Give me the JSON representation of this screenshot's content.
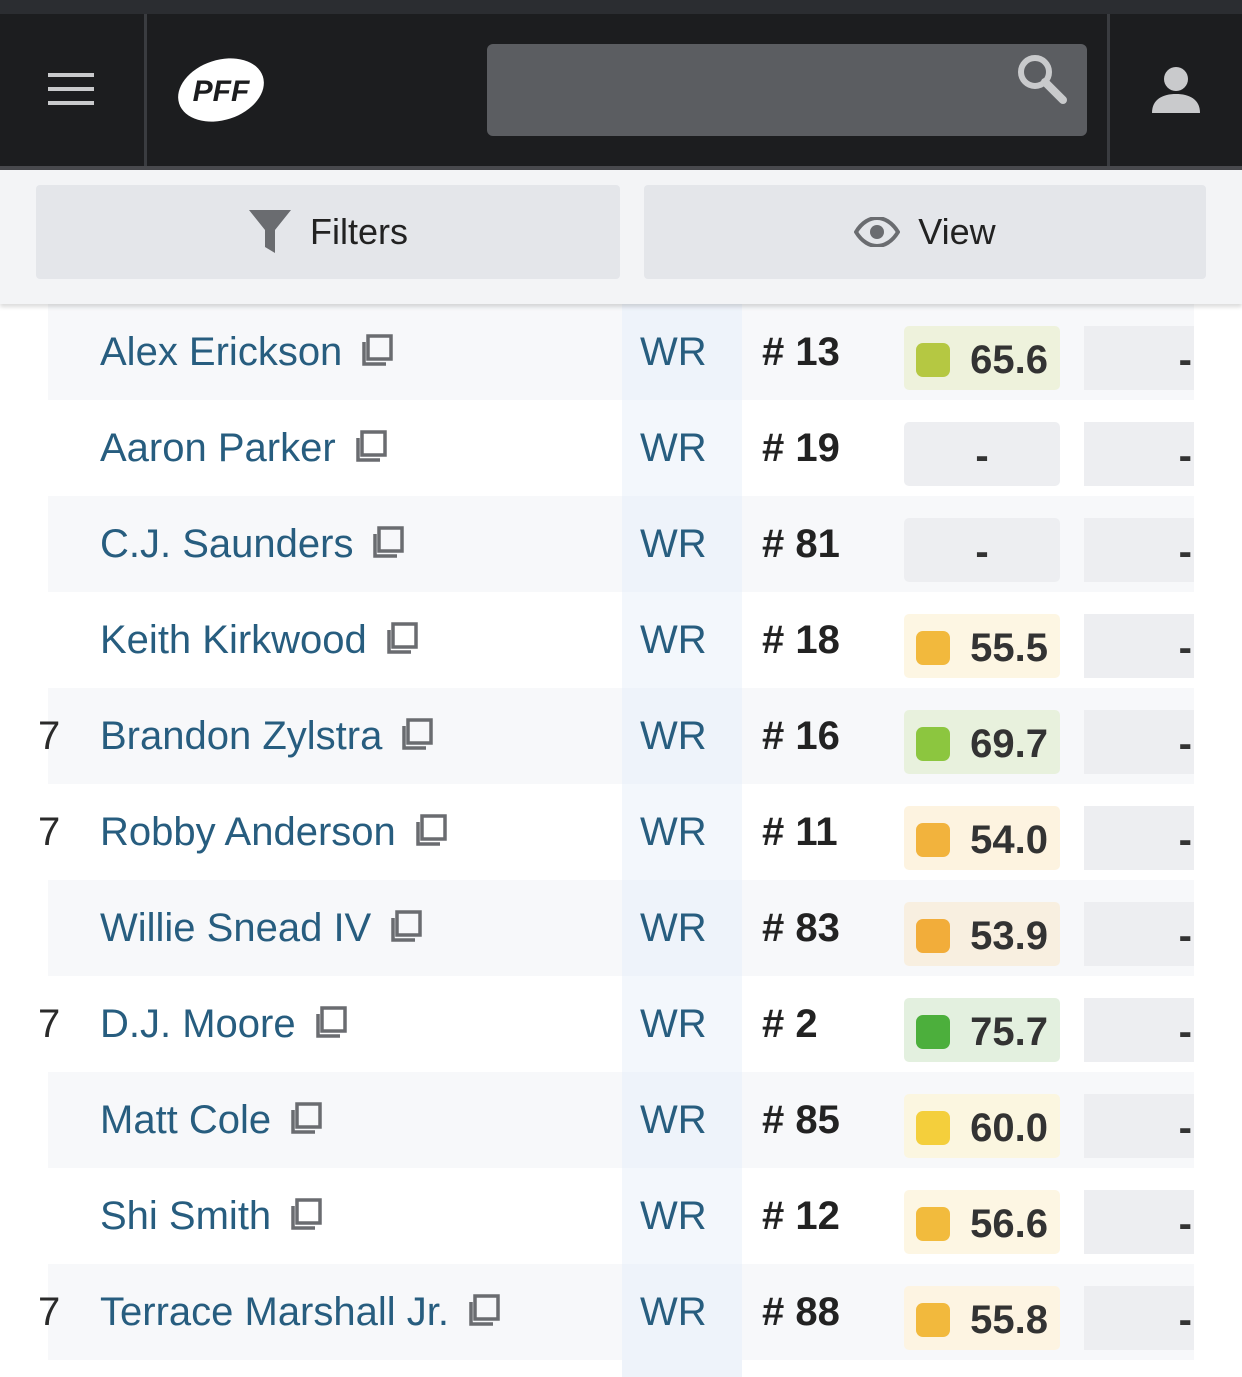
{
  "header": {
    "logo_text": "PFF",
    "search": {
      "placeholder": "",
      "value": ""
    }
  },
  "toolbar": {
    "filters_label": "Filters",
    "view_label": "View"
  },
  "colors": {
    "header_bg": "#1c1d1f",
    "player_link": "#275d7f",
    "grade_yellow_green": "#b5c842",
    "grade_light_green": "#8cc63f",
    "grade_green": "#4caf3c",
    "grade_orange": "#f2b33d",
    "grade_yellow": "#f4cf3c"
  },
  "rows": [
    {
      "prefix": "",
      "name": "Alex Erickson",
      "position": "WR",
      "jersey": "# 13",
      "grade": "65.6",
      "grade_color": "#b5c842",
      "grade_bg": "#eef2dc",
      "stat": "-"
    },
    {
      "prefix": "",
      "name": "Aaron Parker",
      "position": "WR",
      "jersey": "# 19",
      "grade": "-",
      "grade_color": "",
      "grade_bg": "#edeef1",
      "stat": "-"
    },
    {
      "prefix": "",
      "name": "C.J. Saunders",
      "position": "WR",
      "jersey": "# 81",
      "grade": "-",
      "grade_color": "",
      "grade_bg": "#edeef1",
      "stat": "-"
    },
    {
      "prefix": "",
      "name": "Keith Kirkwood",
      "position": "WR",
      "jersey": "# 18",
      "grade": "55.5",
      "grade_color": "#f2b93d",
      "grade_bg": "#fdf6e3",
      "stat": "-"
    },
    {
      "prefix": "7",
      "name": "Brandon Zylstra",
      "position": "WR",
      "jersey": "# 16",
      "grade": "69.7",
      "grade_color": "#8cc63f",
      "grade_bg": "#e8f1dd",
      "stat": "-"
    },
    {
      "prefix": "7",
      "name": "Robby Anderson",
      "position": "WR",
      "jersey": "# 11",
      "grade": "54.0",
      "grade_color": "#f2b33d",
      "grade_bg": "#fdf3e0",
      "stat": "-"
    },
    {
      "prefix": "",
      "name": "Willie Snead IV",
      "position": "WR",
      "jersey": "# 83",
      "grade": "53.9",
      "grade_color": "#f2ad3a",
      "grade_bg": "#f8efe0",
      "stat": "-"
    },
    {
      "prefix": "7",
      "name": "D.J. Moore",
      "position": "WR",
      "jersey": "# 2",
      "grade": "75.7",
      "grade_color": "#4caf3c",
      "grade_bg": "#e3f0df",
      "stat": "-"
    },
    {
      "prefix": "",
      "name": "Matt Cole",
      "position": "WR",
      "jersey": "# 85",
      "grade": "60.0",
      "grade_color": "#f4cf3c",
      "grade_bg": "#fbf6e0",
      "stat": "-"
    },
    {
      "prefix": "",
      "name": "Shi Smith",
      "position": "WR",
      "jersey": "# 12",
      "grade": "56.6",
      "grade_color": "#f2bb3d",
      "grade_bg": "#fdf6e3",
      "stat": "-"
    },
    {
      "prefix": "7",
      "name": "Terrace Marshall Jr.",
      "position": "WR",
      "jersey": "# 88",
      "grade": "55.8",
      "grade_color": "#f2b93d",
      "grade_bg": "#fdf4e2",
      "stat": "-"
    }
  ]
}
